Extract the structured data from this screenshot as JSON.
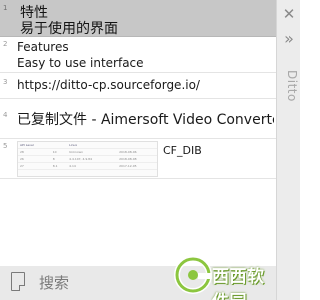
{
  "window": {
    "title": "Ditto",
    "close_symbol": "✕",
    "expand_symbol": "»"
  },
  "clips": [
    {
      "index": "1",
      "lines": [
        "特性",
        "易于使用的界面"
      ]
    },
    {
      "index": "2",
      "lines": [
        "Features",
        "Easy to use interface"
      ]
    },
    {
      "index": "3",
      "lines": [
        "https://ditto-cp.sourceforge.io/"
      ]
    },
    {
      "index": "4",
      "lines": [
        "已复制文件 - Aimersoft Video Converter U"
      ]
    },
    {
      "index": "5",
      "format": "CF_DIB",
      "thumbnail_rows": [
        [
          "API Level",
          "",
          "Linux",
          ""
        ],
        [
          "28",
          "10",
          "Unknown",
          "2018-08-06"
        ],
        [
          "26",
          "8",
          "4.4.107, 4.9.84",
          "2018-08-08"
        ],
        [
          "27",
          "8.1",
          "4.14",
          "2017-12-05"
        ]
      ]
    }
  ],
  "footer": {
    "search_placeholder": "搜索"
  },
  "watermark": {
    "text": "西西软件园"
  }
}
